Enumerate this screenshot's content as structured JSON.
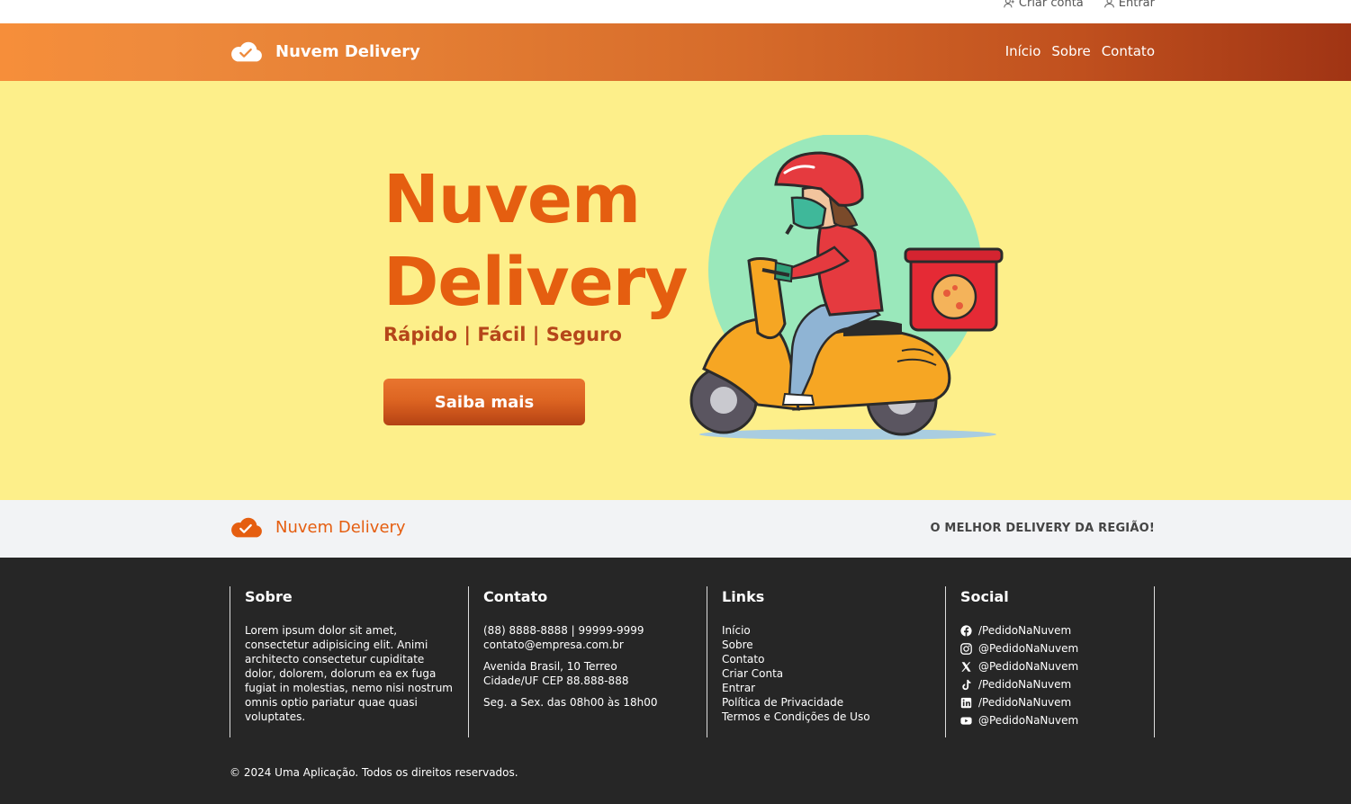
{
  "topbar": {
    "create_account": "Criar conta",
    "login": "Entrar"
  },
  "navbar": {
    "brand": "Nuvem Delivery",
    "menu": [
      "Início",
      "Sobre",
      "Contato"
    ]
  },
  "hero": {
    "title_line1": "Nuvem",
    "title_line2": "Delivery",
    "subtitle": "Rápido | Fácil | Seguro",
    "cta": "Saiba mais"
  },
  "band": {
    "brand": "Nuvem Delivery",
    "slogan": "O MELHOR DELIVERY DA REGIÃO!"
  },
  "footer": {
    "about": {
      "heading": "Sobre",
      "text": "Lorem ipsum dolor sit amet, consectetur adipisicing elit. Animi architecto consectetur cupiditate dolor, dolorem, dolorum ea ex fuga fugiat in molestias, nemo nisi nostrum omnis optio pariatur quae quasi voluptates."
    },
    "contact": {
      "heading": "Contato",
      "phone": "(88) 8888-8888 | 99999-9999",
      "email": "contato@empresa.com.br",
      "address1": "Avenida Brasil, 10 Terreo",
      "address2": "Cidade/UF CEP 88.888-888",
      "hours": "Seg. a Sex. das 08h00 às 18h00"
    },
    "links": {
      "heading": "Links",
      "items": [
        "Início",
        "Sobre",
        "Contato",
        "Criar Conta",
        "Entrar",
        "Política de Privacidade",
        "Termos e Condições de Uso"
      ]
    },
    "social": {
      "heading": "Social",
      "items": [
        {
          "icon": "facebook-icon",
          "label": "/PedidoNaNuvem"
        },
        {
          "icon": "instagram-icon",
          "label": "@PedidoNaNuvem"
        },
        {
          "icon": "x-icon",
          "label": "@PedidoNaNuvem"
        },
        {
          "icon": "tiktok-icon",
          "label": "/PedidoNaNuvem"
        },
        {
          "icon": "linkedin-icon",
          "label": "/PedidoNaNuvem"
        },
        {
          "icon": "youtube-icon",
          "label": "@PedidoNaNuvem"
        }
      ]
    },
    "copyright": "© 2024 Uma Aplicação. Todos os direitos reservados."
  },
  "colors": {
    "accent": "#e55e10",
    "hero_bg": "#fdef8a",
    "footer_bg": "#262626",
    "band_bg": "#f2f3f5"
  }
}
